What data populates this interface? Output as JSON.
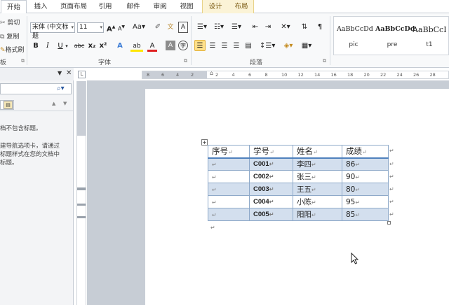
{
  "tabs": [
    {
      "label": "开始",
      "active": true
    },
    {
      "label": "插入"
    },
    {
      "label": "页面布局"
    },
    {
      "label": "引用"
    },
    {
      "label": "邮件"
    },
    {
      "label": "审阅"
    },
    {
      "label": "视图"
    },
    {
      "label": "设计",
      "contextual": true
    },
    {
      "label": "布局",
      "contextual": true
    }
  ],
  "clipboard": {
    "cut": "剪切",
    "copy": "复制",
    "format_painter": "格式刷",
    "group_label": "板"
  },
  "font": {
    "name": "宋体 (中文标题",
    "size": "11",
    "group_label": "字体",
    "change_case": "Aa",
    "grow": "A",
    "shrink": "A",
    "clear": "A",
    "bold": "B",
    "italic": "I",
    "underline": "U",
    "strike": "abc",
    "subscript": "x₂",
    "superscript": "x²",
    "font_color": "A",
    "highlight": "ab"
  },
  "paragraph": {
    "group_label": "段落"
  },
  "styles": {
    "items": [
      {
        "sample": "AaBbCcDd",
        "name": "pic"
      },
      {
        "sample": "AaBbCcDd",
        "name": "pre"
      },
      {
        "sample": "AaBbCcI",
        "name": "t1"
      }
    ]
  },
  "nav_pane": {
    "text_lines": [
      "档不包含标题。",
      "建导航选项卡，请通过",
      "标题样式在您的文档中",
      "标题。"
    ]
  },
  "ruler": {
    "labels": [
      "8",
      "6",
      "4",
      "2",
      "2",
      "4",
      "6",
      "8",
      "10",
      "12",
      "14",
      "16",
      "18",
      "20",
      "22",
      "24",
      "26",
      "28"
    ]
  },
  "table": {
    "headers": [
      "序号",
      "学号",
      "姓名",
      "成绩"
    ],
    "rows": [
      {
        "seq": "",
        "id": "C001",
        "name": "李四",
        "score": "86"
      },
      {
        "seq": "",
        "id": "C002",
        "name": "张三",
        "score": "90"
      },
      {
        "seq": "",
        "id": "C003",
        "name": "王五",
        "score": "80"
      },
      {
        "seq": "",
        "id": "C004",
        "name": "小陈",
        "score": "95"
      },
      {
        "seq": "",
        "id": "C005",
        "name": "阳阳",
        "score": "85"
      }
    ]
  }
}
